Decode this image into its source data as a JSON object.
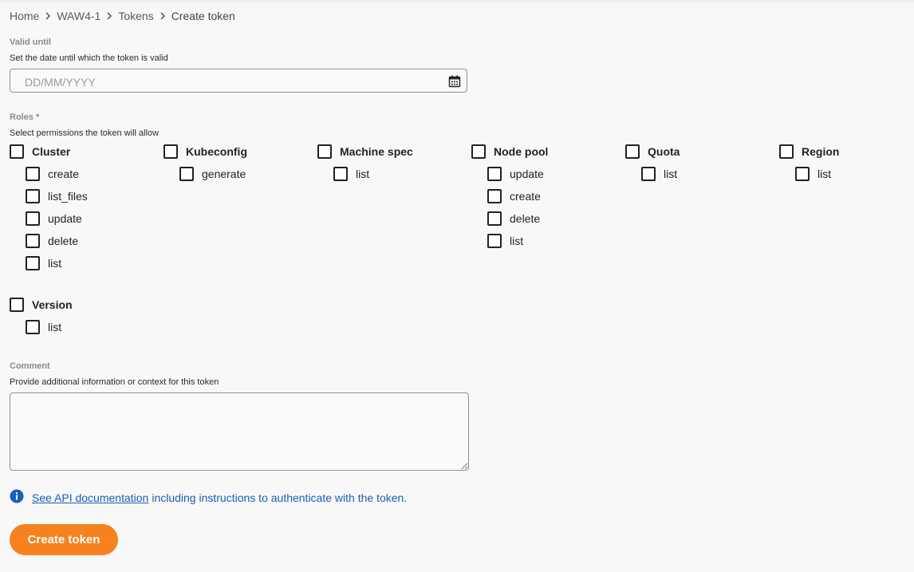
{
  "breadcrumb": [
    "Home",
    "WAW4-1",
    "Tokens",
    "Create token"
  ],
  "valid_until": {
    "label": "Valid until",
    "help": "Set the date until which the token is valid",
    "placeholder": "DD/MM/YYYY",
    "value": ""
  },
  "roles": {
    "label": "Roles *",
    "help": "Select permissions the token will allow",
    "groups": [
      {
        "name": "Cluster",
        "checked": false,
        "permissions": [
          {
            "label": "create",
            "checked": false
          },
          {
            "label": "list_files",
            "checked": false
          },
          {
            "label": "update",
            "checked": false
          },
          {
            "label": "delete",
            "checked": false
          },
          {
            "label": "list",
            "checked": false
          }
        ]
      },
      {
        "name": "Kubeconfig",
        "checked": false,
        "permissions": [
          {
            "label": "generate",
            "checked": false
          }
        ]
      },
      {
        "name": "Machine spec",
        "checked": false,
        "permissions": [
          {
            "label": "list",
            "checked": false
          }
        ]
      },
      {
        "name": "Node pool",
        "checked": false,
        "permissions": [
          {
            "label": "update",
            "checked": false
          },
          {
            "label": "create",
            "checked": false
          },
          {
            "label": "delete",
            "checked": false
          },
          {
            "label": "list",
            "checked": false
          }
        ]
      },
      {
        "name": "Quota",
        "checked": false,
        "permissions": [
          {
            "label": "list",
            "checked": false
          }
        ]
      },
      {
        "name": "Region",
        "checked": false,
        "permissions": [
          {
            "label": "list",
            "checked": false
          }
        ]
      },
      {
        "name": "Version",
        "checked": false,
        "permissions": [
          {
            "label": "list",
            "checked": false
          }
        ]
      }
    ]
  },
  "comment": {
    "label": "Comment",
    "help": "Provide additional information or context for this token",
    "value": ""
  },
  "info": {
    "icon": "info-icon",
    "link_text": "See API documentation",
    "rest_text": "including instructions to authenticate with the token."
  },
  "submit_label": "Create token",
  "colors": {
    "accent": "#f5821f",
    "link": "#1a5dba"
  }
}
